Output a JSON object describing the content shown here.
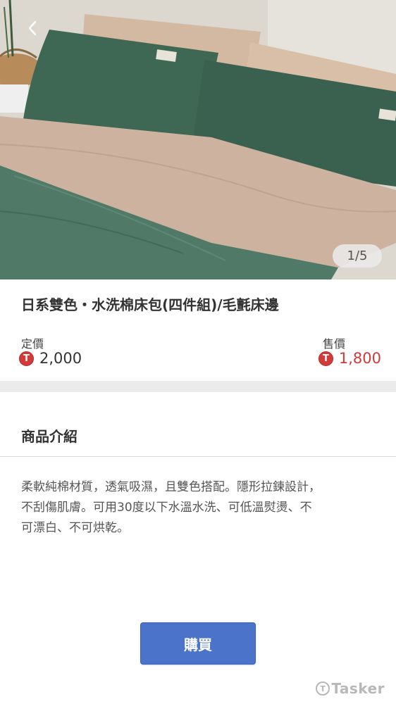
{
  "hero": {
    "image_counter": "1/5"
  },
  "product": {
    "title": "日系雙色・水洗棉床包(四件組)/毛氈床邊",
    "list_price_label": "定價",
    "list_price": "2,000",
    "sale_price_label": "售價",
    "sale_price": "1,800",
    "currency_icon_letter": "T"
  },
  "intro": {
    "section_title": "商品介紹",
    "description_lines": [
      "柔軟純棉材質，透氣吸濕，且雙色搭配。隱形拉鍊設計，",
      "不刮傷肌膚。可用30度以下水溫水洗、可低溫熨燙、不",
      "可漂白、不可烘乾。"
    ]
  },
  "actions": {
    "buy_label": "購買"
  },
  "watermark": {
    "text": "Tasker"
  },
  "colors": {
    "accent_button": "#4a73c9",
    "sale_price": "#d23a3a",
    "token_icon": "#d33a3a"
  },
  "icons": {
    "back": "chevron-left-icon",
    "currency": "token-t-icon"
  }
}
